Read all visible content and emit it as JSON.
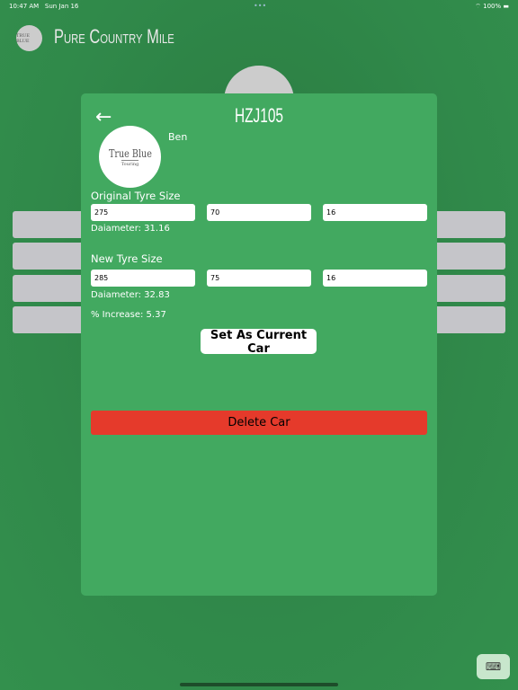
{
  "status": {
    "time": "10:47 AM",
    "date": "Sun Jan 16",
    "battery": "100%",
    "wifi_icon": "wifi-icon"
  },
  "app": {
    "title": "Pure Country Mile",
    "logo_text": "True Blue"
  },
  "modal": {
    "title": "HZJ105",
    "owner": "Ben",
    "avatar_text": "True Blue",
    "avatar_sub": "Touring",
    "original": {
      "label": "Original Tyre Size",
      "width": "275",
      "profile": "70",
      "rim": "16",
      "diameter": "Daiameter: 31.16"
    },
    "new": {
      "label": "New Tyre Size",
      "width": "285",
      "profile": "75",
      "rim": "16",
      "diameter": "Daiameter: 32.83"
    },
    "increase": "% Increase: 5.37",
    "set_current": "Set As Current Car",
    "delete": "Delete Car"
  },
  "colors": {
    "background": "#30894a",
    "modal": "#42a960",
    "delete": "#e53a2b"
  }
}
